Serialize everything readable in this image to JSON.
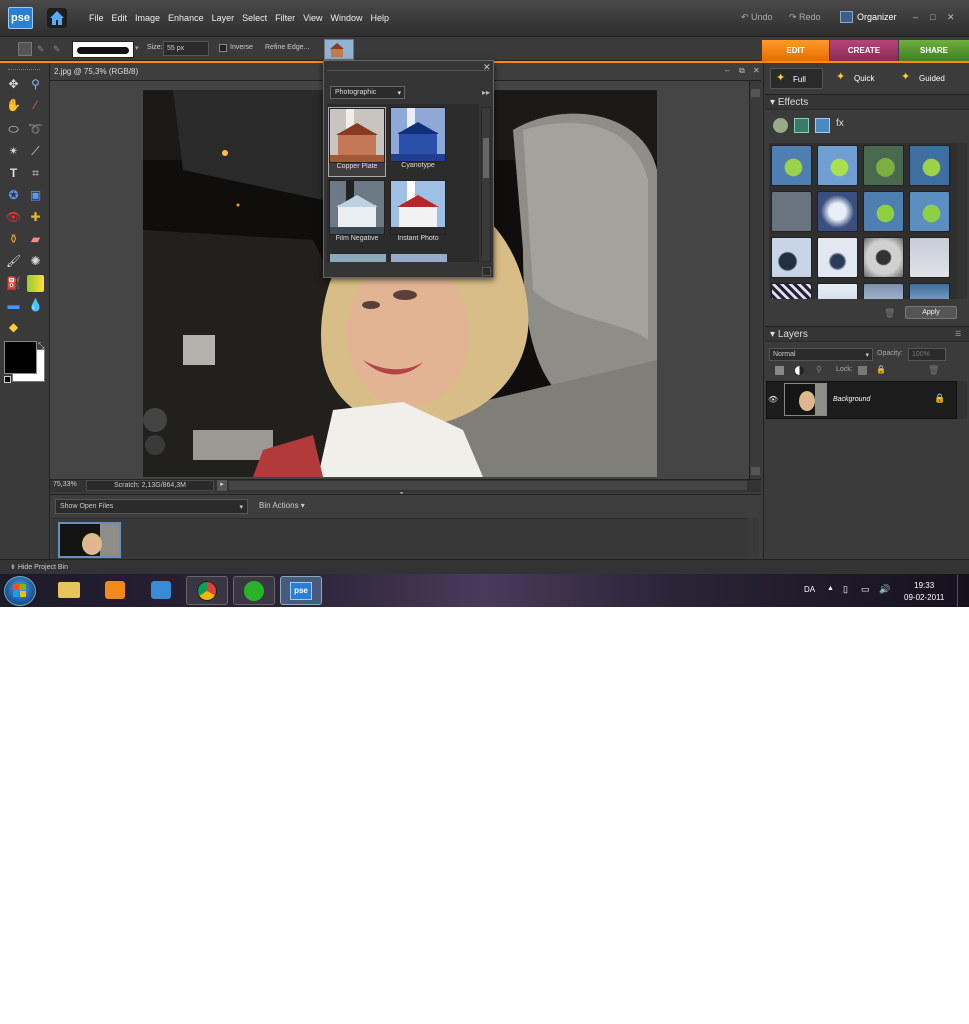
{
  "app": {
    "logo": "pse",
    "title_doc": "2.jpg @ 75,3% (RGB/8)"
  },
  "menu": [
    "File",
    "Edit",
    "Image",
    "Enhance",
    "Layer",
    "Select",
    "Filter",
    "View",
    "Window",
    "Help"
  ],
  "toolbar": {
    "undo": "Undo",
    "redo": "Redo",
    "organizer": "Organizer"
  },
  "mode_tabs": {
    "edit": "EDIT",
    "create": "CREATE",
    "share": "SHARE"
  },
  "options": {
    "size_label": "Size:",
    "size_value": "55 px",
    "inverse": "Inverse",
    "refine": "Refine Edge..."
  },
  "edit_modes": {
    "full": "Full",
    "quick": "Quick",
    "guided": "Guided"
  },
  "effects": {
    "title": "Effects",
    "apply": "Apply"
  },
  "layers": {
    "title": "Layers",
    "blend": "Normal",
    "opacity_label": "Opacity:",
    "opacity_value": "100%",
    "lock_label": "Lock:",
    "layer_name": "Background"
  },
  "popup": {
    "category": "Photographic",
    "styles": [
      "Copper Plate",
      "Cyanotype",
      "Film Negative",
      "Instant Photo"
    ]
  },
  "status": {
    "zoom": "75,33%",
    "scratch": "Scratch: 2,13G/864,3M"
  },
  "bin": {
    "show": "Show Open Files",
    "actions": "Bin Actions",
    "hide": "Hide Project Bin"
  },
  "taskbar": {
    "lang": "DA",
    "time": "19:33",
    "date": "09-02-2011"
  },
  "colors": {
    "edit": "#ff8a1a",
    "create": "#a0366a",
    "share": "#4f9a2c",
    "accent": "#2a7fd0"
  }
}
